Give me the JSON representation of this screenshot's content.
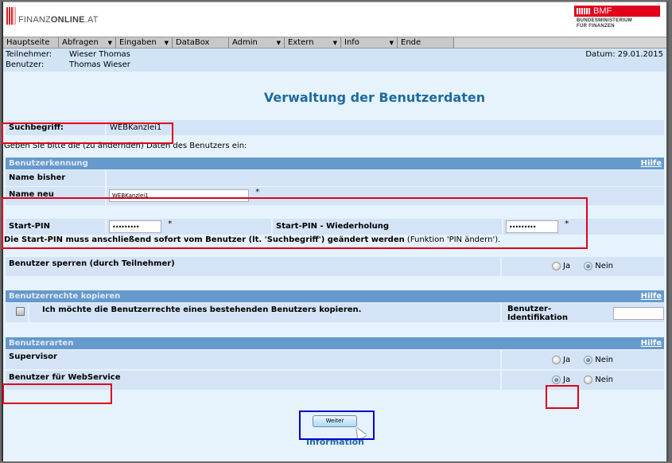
{
  "header": {
    "logo_left": {
      "light": "FINANZ",
      "bold": "ONLINE",
      "suffix": ".AT"
    },
    "logo_right": {
      "title": "BMF",
      "line1": "BUNDESMINISTERIUM",
      "line2": "FÜR FINANZEN"
    },
    "brand_color": "#e2001a"
  },
  "menu": {
    "items": [
      {
        "label": "Hauptseite",
        "dropdown": false
      },
      {
        "label": "Abfragen",
        "dropdown": true
      },
      {
        "label": "Eingaben",
        "dropdown": true
      },
      {
        "label": "DataBox",
        "dropdown": false
      },
      {
        "label": "Admin",
        "dropdown": true
      },
      {
        "label": "Extern",
        "dropdown": true
      },
      {
        "label": "Info",
        "dropdown": true
      },
      {
        "label": "Ende",
        "dropdown": false
      }
    ],
    "arrow_glyph": "▼"
  },
  "info": {
    "teilnehmer_label": "Teilnehmer:",
    "teilnehmer_value": "Wieser Thomas",
    "benutzer_label": "Benutzer:",
    "benutzer_value": "Thomas Wieser",
    "datum": "Datum: 29.01.2015"
  },
  "page": {
    "title": "Verwaltung der Benutzerdaten",
    "search_label": "Suchbegriff:",
    "search_value": "WEBKanzlei1",
    "instruction": "Geben Sie bitte die (zu ändernden) Daten des Benutzers ein:"
  },
  "benutzerkennung": {
    "heading": "Benutzerkennung",
    "help": "Hilfe",
    "name_bisher_label": "Name bisher",
    "name_neu_label": "Name neu",
    "name_neu_value": "WEBKanzlei1",
    "required_mark": "*",
    "start_pin_label": "Start-PIN",
    "start_pin_value": "•••••••••",
    "start_pin_repeat_label": "Start-PIN - Wiederholung",
    "start_pin_repeat_value": "•••••••••",
    "pin_note_bold": "Die Start-PIN muss anschließend sofort vom Benutzer (lt. 'Suchbegriff') geändert werden",
    "pin_note_normal": " (Funktion 'PIN ändern').",
    "sperren_label": "Benutzer sperren (durch Teilnehmer)",
    "sperren_options": [
      "Ja",
      "Nein"
    ],
    "sperren_selected": "Nein"
  },
  "rechte": {
    "heading": "Benutzerrechte kopieren",
    "help": "Hilfe",
    "checkbox_label": "Ich möchte die Benutzerrechte eines bestehenden Benutzers kopieren.",
    "checked": false,
    "ident_label": "Benutzer-Identifikation",
    "ident_value": ""
  },
  "arten": {
    "heading": "Benutzerarten",
    "help": "Hilfe",
    "supervisor_label": "Supervisor",
    "supervisor_options": [
      "Ja",
      "Nein"
    ],
    "supervisor_selected": "Nein",
    "webservice_label": "Benutzer für WebService",
    "webservice_options": [
      "Ja",
      "Nein"
    ],
    "webservice_selected": "Ja"
  },
  "footer": {
    "weiter_button": "Weiter",
    "info_link": "Information"
  }
}
